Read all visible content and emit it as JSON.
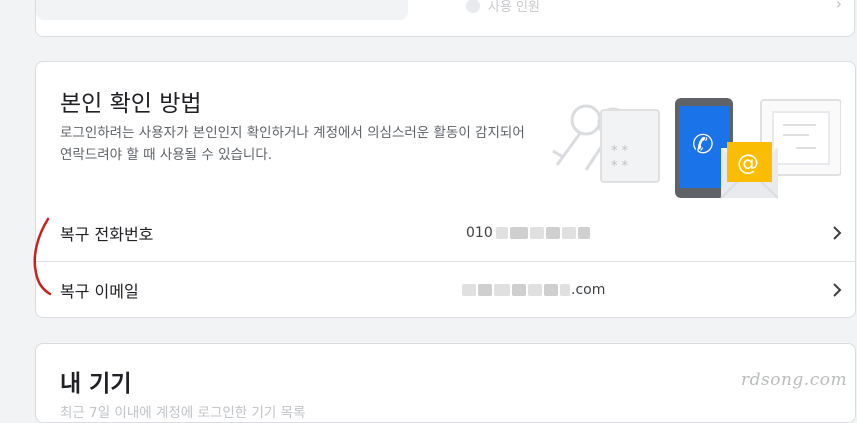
{
  "top_card": {
    "item_text": "사용 인원"
  },
  "recovery": {
    "title": "본인 확인 방법",
    "description": "로그인하려는 사용자가 본인인지 확인하거나 계정에서 의심스러운 활동이 감지되어 연락드려야 할 때 사용될 수 있습니다.",
    "phone": {
      "label": "복구 전화번호",
      "value_prefix": "010"
    },
    "email": {
      "label": "복구 이메일",
      "value_suffix": ".com"
    }
  },
  "devices": {
    "title": "내 기기",
    "description": "최근 7일 이내에 계정에 로그인한 기기 목록"
  },
  "watermark": "rdsong.com",
  "colors": {
    "phone_blue": "#1a73e8",
    "mail_yellow": "#fbbc04",
    "annotation_red": "#c5221f"
  }
}
